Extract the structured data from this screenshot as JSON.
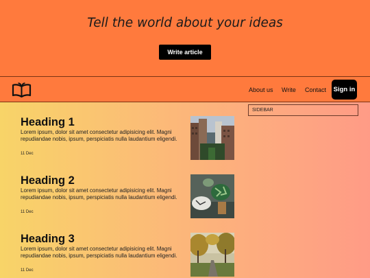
{
  "hero": {
    "title": "Tell the world about your ideas",
    "button_label": "Write article"
  },
  "nav": {
    "logo_icon": "open-book-icon",
    "links": [
      "About us",
      "Write",
      "Contact"
    ],
    "signin_label": "Sign in"
  },
  "colors": {
    "accent": "#ff7a3d",
    "button": "#000000",
    "gradient": [
      "#f8d468",
      "#fcb67a",
      "#ff9b86"
    ]
  },
  "sidebar": {
    "label": "SIDEBAR"
  },
  "posts": [
    {
      "heading": "Heading 1",
      "body": "Lorem ipsum, dolor sit amet consectetur adipisicing elit. Magni repudiandae nobis, ipsum, perspiciatis nulla laudantium eligendi.",
      "date": "11 Dec",
      "image": "city-buildings-image"
    },
    {
      "heading": "Heading 2",
      "body": "Lorem ipsum, dolor sit amet consectetur adipisicing elit. Magni repudiandae nobis, ipsum, perspiciatis nulla laudantium eligendi.",
      "date": "11 Dec",
      "image": "pillows-plants-image"
    },
    {
      "heading": "Heading 3",
      "body": "Lorem ipsum, dolor sit amet consectetur adipisicing elit. Magni repudiandae nobis, ipsum, perspiciatis nulla laudantium eligendi.",
      "date": "11 Dec",
      "image": "autumn-road-image"
    }
  ]
}
